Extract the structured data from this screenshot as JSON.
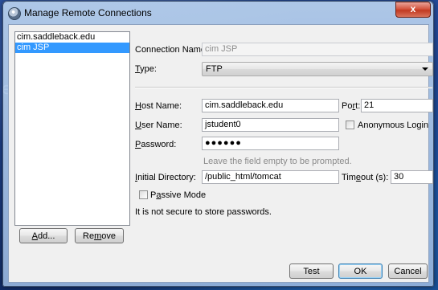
{
  "window": {
    "title": "Manage Remote Connections",
    "close_glyph": "x"
  },
  "connections": [
    {
      "label": "cim.saddleback.edu",
      "selected": false
    },
    {
      "label": "cim JSP",
      "selected": true
    }
  ],
  "list_buttons": {
    "add_prefix": "",
    "add_mnemonic": "A",
    "add_rest": "dd...",
    "remove_prefix": "Re",
    "remove_mnemonic": "m",
    "remove_rest": "ove"
  },
  "form": {
    "connection_name": {
      "label": "Connection Name:",
      "value": "cim JSP"
    },
    "type": {
      "label_mnemonic": "T",
      "label_rest": "ype:",
      "value": "FTP"
    },
    "host_name": {
      "label_mnemonic": "H",
      "label_rest": "ost Name:",
      "value": "cim.saddleback.edu"
    },
    "port": {
      "label_prefix": "Po",
      "label_mnemonic": "r",
      "label_rest": "t:",
      "value": "21"
    },
    "user_name": {
      "label_mnemonic": "U",
      "label_rest": "ser Name:",
      "value": "jstudent0"
    },
    "anonymous_login": {
      "label": "Anonymous Login",
      "checked": false
    },
    "password": {
      "label_mnemonic": "P",
      "label_rest": "assword:",
      "masked_value": "●●●●●●",
      "hint": "Leave the field empty to be prompted."
    },
    "initial_directory": {
      "label_mnemonic": "I",
      "label_rest": "nitial Directory:",
      "value": "/public_html/tomcat"
    },
    "timeout": {
      "label_prefix": "Tim",
      "label_mnemonic": "e",
      "label_rest": "out (s):",
      "value": "30"
    },
    "passive_mode": {
      "label_prefix": "P",
      "label_mnemonic": "a",
      "label_rest": "ssive Mode",
      "checked": false
    },
    "security_note": "It is not secure to store passwords."
  },
  "footer": {
    "test": "Test",
    "ok": "OK",
    "cancel": "Cancel"
  },
  "icons": {
    "app": "netbeans-cube-icon",
    "close": "close-icon",
    "dropdown": "chevron-down-icon"
  },
  "colors": {
    "selection": "#3399ff",
    "close_button": "#c13a22",
    "desktop": "#1e3f8a"
  }
}
